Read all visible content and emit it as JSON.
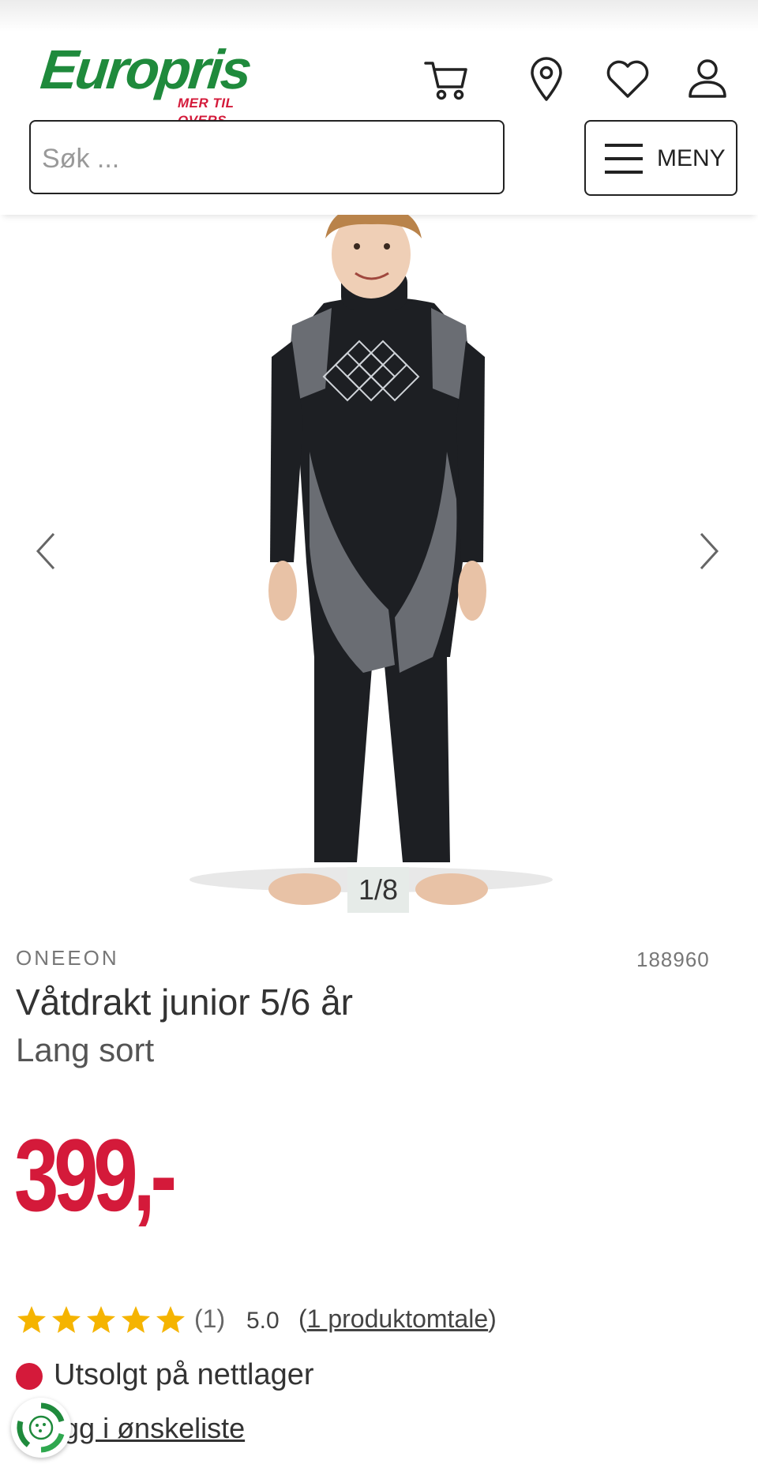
{
  "header": {
    "logo_text": "Europris",
    "logo_tagline": "MER TIL OVERS",
    "icons": [
      "cart-icon",
      "location-pin-icon",
      "heart-icon",
      "user-icon"
    ],
    "search_placeholder": "Søk ...",
    "menu_label": "MENY"
  },
  "gallery": {
    "counter": "1/8",
    "prev_icon": "chevron-left-icon",
    "next_icon": "chevron-right-icon"
  },
  "product": {
    "brand": "ONEEON",
    "sku": "188960",
    "title": "Våtdrakt junior 5/6 år",
    "subtitle": "Lang sort",
    "price": "399,-"
  },
  "rating": {
    "stars_filled": 5,
    "stars_total": 5,
    "count": "(1)",
    "score": "5.0",
    "link_open": "(",
    "link_text": "1 produktomtale",
    "link_close": ")"
  },
  "stock": {
    "status": "Utsolgt på nettlager"
  },
  "wishlist": {
    "label": "egg i ønskeliste"
  },
  "colors": {
    "brand_green": "#1f8a3c",
    "brand_red": "#d41a3a",
    "star_yellow": "#f5b400"
  }
}
